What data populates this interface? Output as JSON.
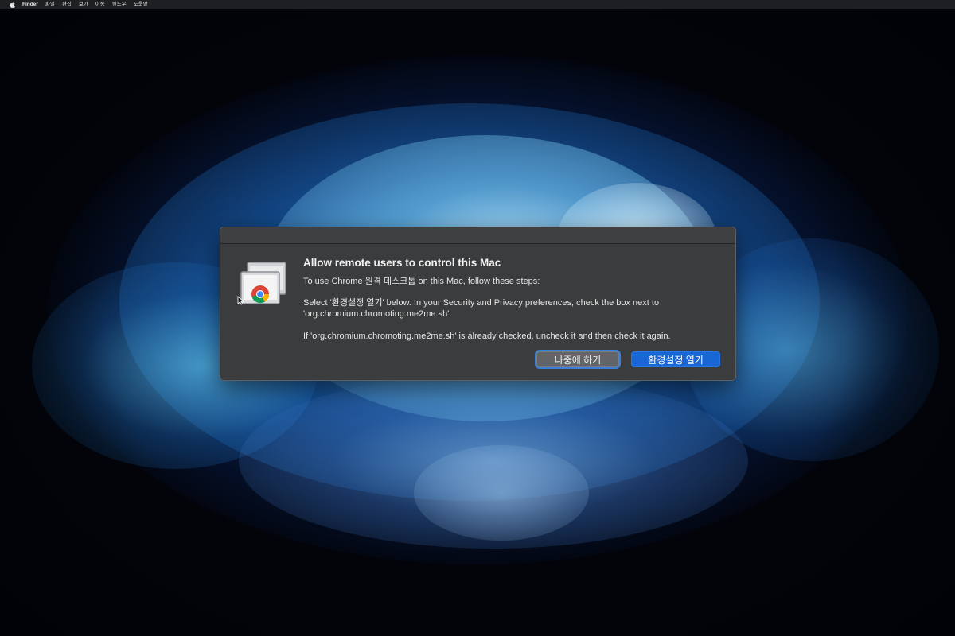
{
  "menubar": {
    "app_name": "Finder",
    "items": [
      "파일",
      "편집",
      "보기",
      "이동",
      "윈도우",
      "도움말"
    ]
  },
  "dialog": {
    "title": "Allow remote users to control this Mac",
    "intro": "To use Chrome 원격 데스크톱 on this Mac, follow these steps:",
    "step_line1": "Select '환경설정 열기' below. In your Security and Privacy preferences, check the box next to",
    "step_line2": "'org.chromium.chromoting.me2me.sh'.",
    "note": "If 'org.chromium.chromoting.me2me.sh' is already checked, uncheck it and then check it again.",
    "later_label": "나중에 하기",
    "open_label": "환경설정 열기"
  },
  "colors": {
    "dialog_bg": "#3b3c3e",
    "primary_button": "#1967d6",
    "secondary_button": "#636467",
    "focus_ring": "#3b7fd6"
  },
  "icons": {
    "menubar": "apple-logo-icon",
    "dialog": "chrome-remote-desktop-icon",
    "pointer": "mouse-cursor-icon"
  }
}
